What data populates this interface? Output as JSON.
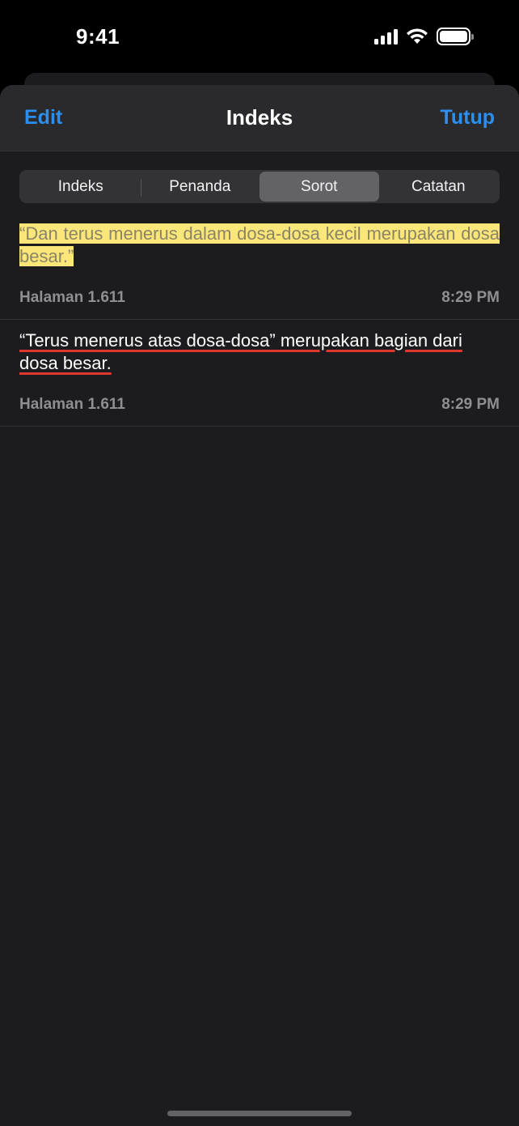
{
  "status_bar": {
    "time": "9:41"
  },
  "nav": {
    "left": "Edit",
    "title": "Indeks",
    "right": "Tutup",
    "accent_color": "#2b8ff0"
  },
  "segments": {
    "items": [
      "Indeks",
      "Penanda",
      "Sorot",
      "Catatan"
    ],
    "selected": "Sorot"
  },
  "entries": [
    {
      "text": "“Dan terus menerus dalam dosa-dosa kecil merupakan dosa besar.”",
      "style": "highlight",
      "page": "Halaman 1.611",
      "time": "8:29 PM"
    },
    {
      "text": "“Terus menerus atas dosa-dosa” merupakan bagian dari dosa besar.",
      "style": "underline",
      "page": "Halaman 1.611",
      "time": "8:29 PM"
    }
  ],
  "colors": {
    "highlight": "#fbe67a",
    "underline": "#e0362f"
  }
}
